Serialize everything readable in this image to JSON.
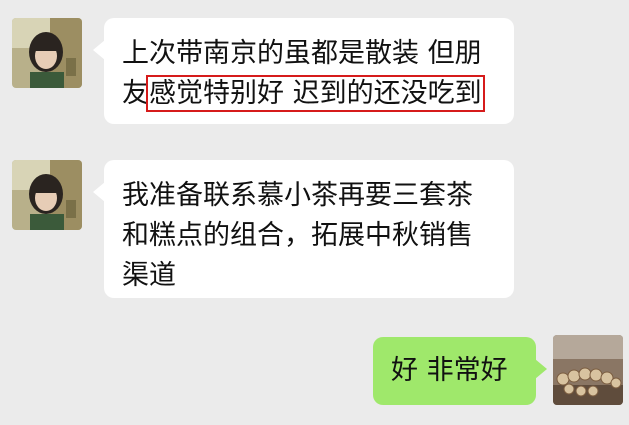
{
  "messages": [
    {
      "side": "left",
      "sender": "contact",
      "lines": {
        "line1": "上次带南京的虽都是散装 但朋",
        "line2_prefix": "友",
        "line2_highlight": "感觉特别好 迟到的还没吃到"
      }
    },
    {
      "side": "left",
      "sender": "contact",
      "lines": {
        "line1": "我准备联系慕小茶再要三套茶",
        "line2": "和糕点的组合，拓展中秋销售",
        "line3": "渠道"
      }
    },
    {
      "side": "right",
      "sender": "self",
      "text": "好 非常好"
    }
  ],
  "colors": {
    "background": "#ebebeb",
    "incoming_bubble": "#ffffff",
    "outgoing_bubble": "#9fe86b",
    "highlight_box": "#d61b1b"
  },
  "icons": {
    "contact_avatar": "girl-photo-avatar",
    "self_avatar": "bead-bracelet-avatar"
  }
}
